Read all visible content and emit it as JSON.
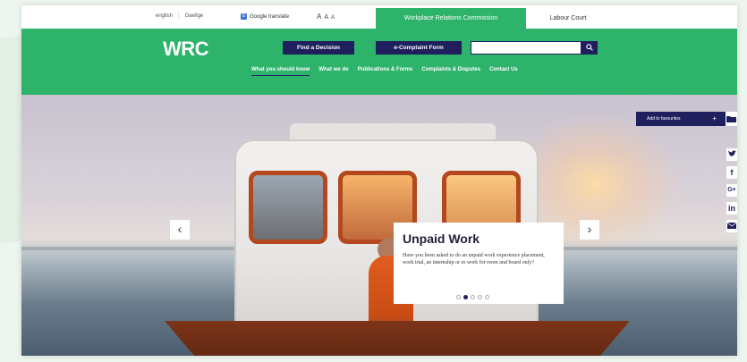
{
  "topbar": {
    "lang_english": "english",
    "lang_irish": "Gaeilge",
    "google_translate": "Google translate",
    "text_size": [
      "A",
      "A",
      "A"
    ],
    "tab_wrc": "Workplace Relations Commission",
    "tab_labour_court": "Labour Court"
  },
  "header": {
    "logo": "WRC",
    "find_decision": "Find a Decision",
    "e_complaint": "e-Complaint Form",
    "search_placeholder": "",
    "nav": [
      {
        "label": "What you should know",
        "active": true
      },
      {
        "label": "What we do",
        "active": false
      },
      {
        "label": "Publications & Forms",
        "active": false
      },
      {
        "label": "Complaints & Disputes",
        "active": false
      },
      {
        "label": "Contact Us",
        "active": false
      }
    ]
  },
  "hero": {
    "prev": "‹",
    "next": "›",
    "card": {
      "title": "Unpaid Work",
      "body": "Have you been asked to do an unpaid work experience placement, work trial, an internship or to work for room and board only?"
    },
    "slides_total": 5,
    "slide_active": 2
  },
  "side": {
    "favourites": "Add to favourites",
    "favourites_plus": "+",
    "social": [
      "twitter-icon",
      "facebook-icon",
      "google-plus-icon",
      "linkedin-icon",
      "email-icon"
    ]
  },
  "colors": {
    "brand_green": "#2db36a",
    "navy": "#1f1f5e"
  }
}
